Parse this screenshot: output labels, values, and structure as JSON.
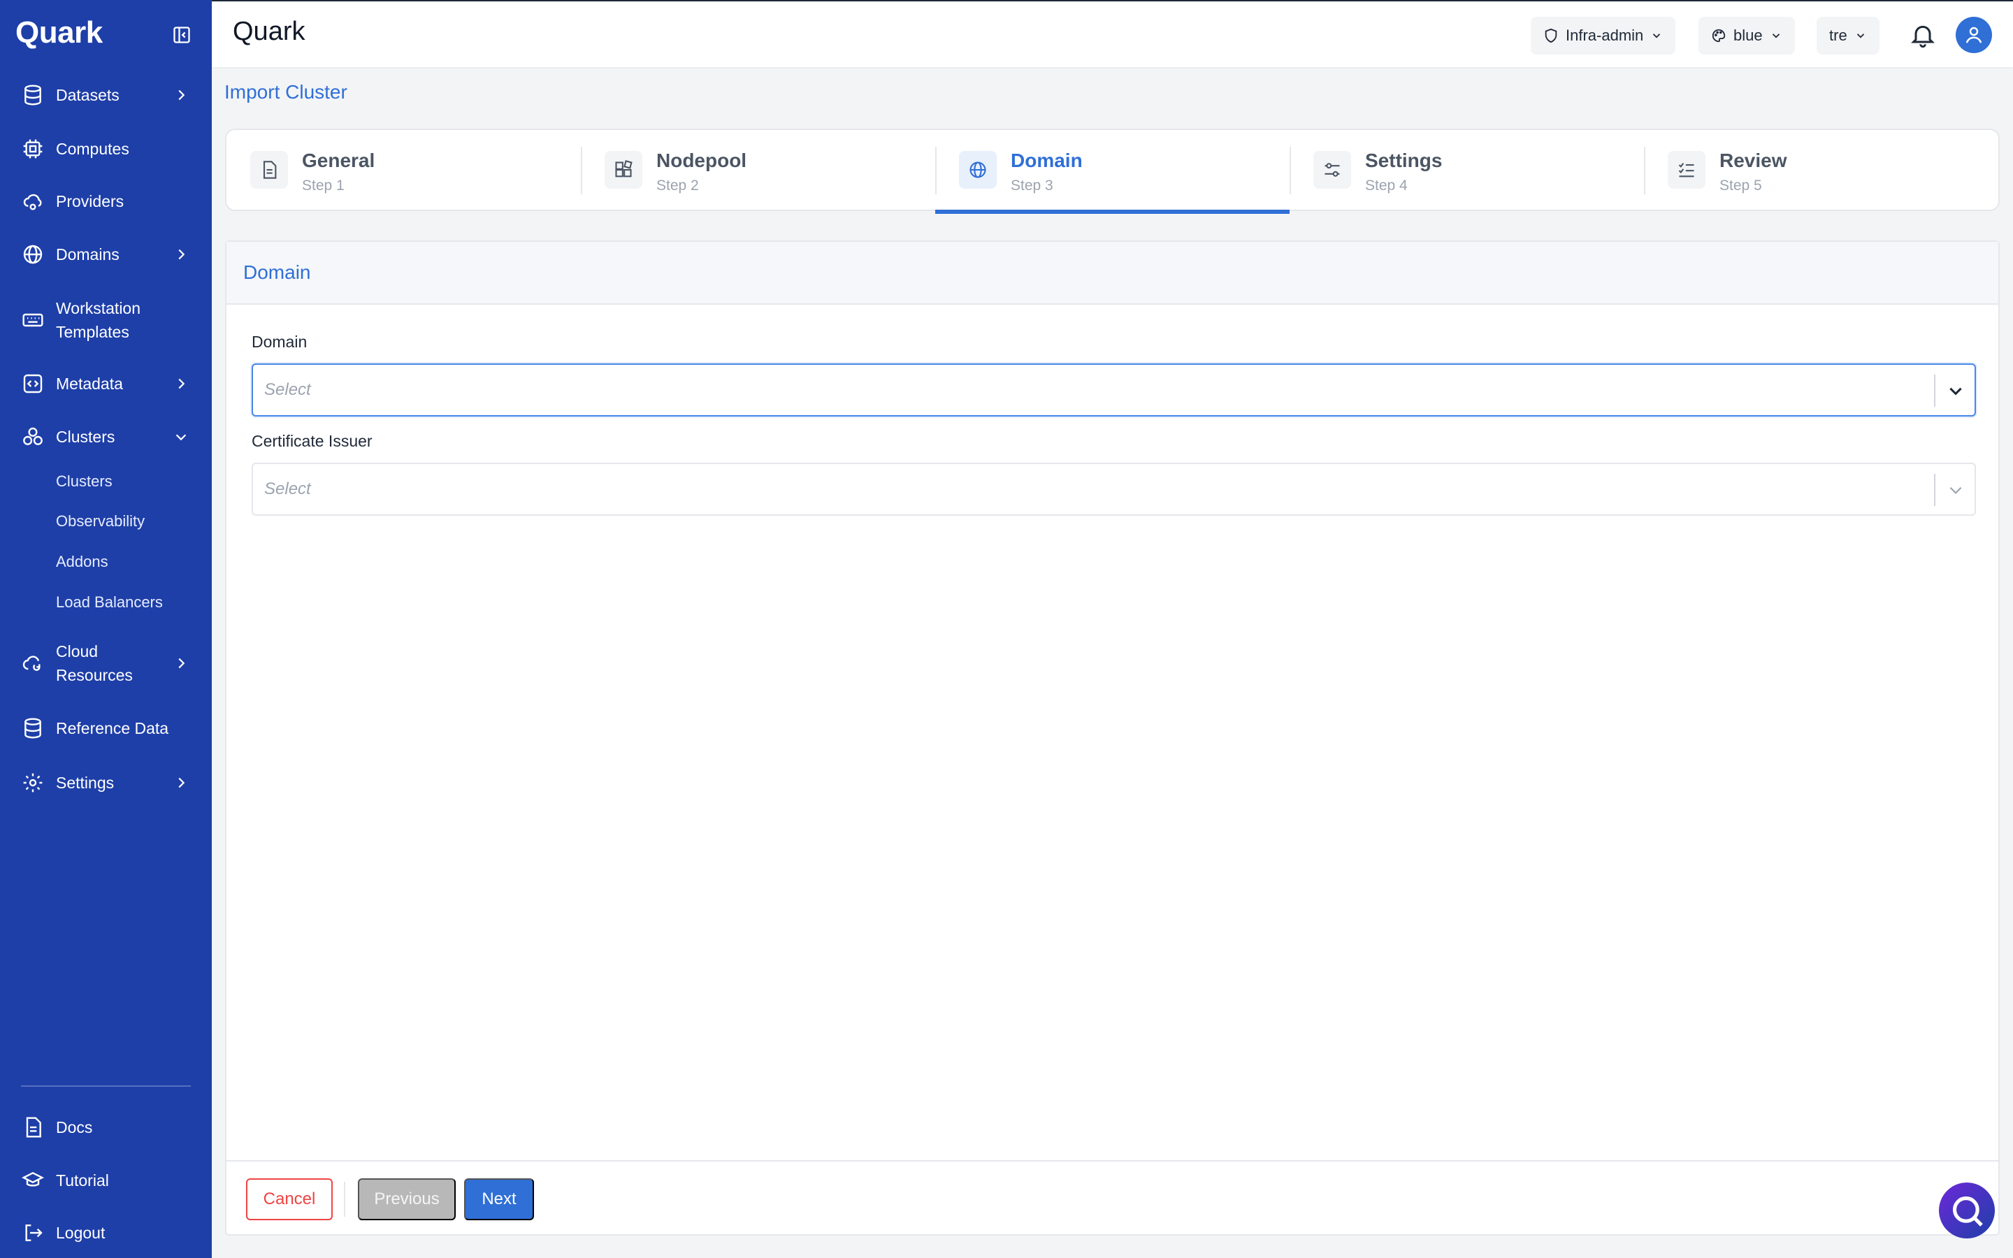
{
  "sidebar": {
    "brand": "Quark",
    "items": [
      {
        "label": "Datasets"
      },
      {
        "label": "Computes"
      },
      {
        "label": "Providers"
      },
      {
        "label": "Domains"
      },
      {
        "label": "Workstation",
        "label2": "Templates"
      },
      {
        "label": "Metadata"
      },
      {
        "label": "Clusters"
      },
      {
        "label": "Cloud",
        "label2": "Resources"
      },
      {
        "label": "Reference Data"
      },
      {
        "label": "Settings"
      }
    ],
    "cluster_subitems": [
      "Clusters",
      "Observability",
      "Addons",
      "Load Balancers"
    ],
    "bottom_items": [
      {
        "label": "Docs"
      },
      {
        "label": "Tutorial"
      },
      {
        "label": "Logout"
      }
    ]
  },
  "header": {
    "title": "Quark",
    "role": "Infra-admin",
    "theme": "blue",
    "tenant": "tre"
  },
  "breadcrumb": "Import Cluster",
  "steps": [
    {
      "title": "General",
      "sub": "Step 1"
    },
    {
      "title": "Nodepool",
      "sub": "Step 2"
    },
    {
      "title": "Domain",
      "sub": "Step 3"
    },
    {
      "title": "Settings",
      "sub": "Step 4"
    },
    {
      "title": "Review",
      "sub": "Step 5"
    }
  ],
  "form": {
    "section_title": "Domain",
    "domain_label": "Domain",
    "domain_placeholder": "Select",
    "issuer_label": "Certificate Issuer",
    "issuer_placeholder": "Select"
  },
  "actions": {
    "cancel": "Cancel",
    "previous": "Previous",
    "next": "Next"
  },
  "colors": {
    "sidebar": "#1e3fa8",
    "accent": "#2f6fd6",
    "danger": "#ef4444"
  }
}
